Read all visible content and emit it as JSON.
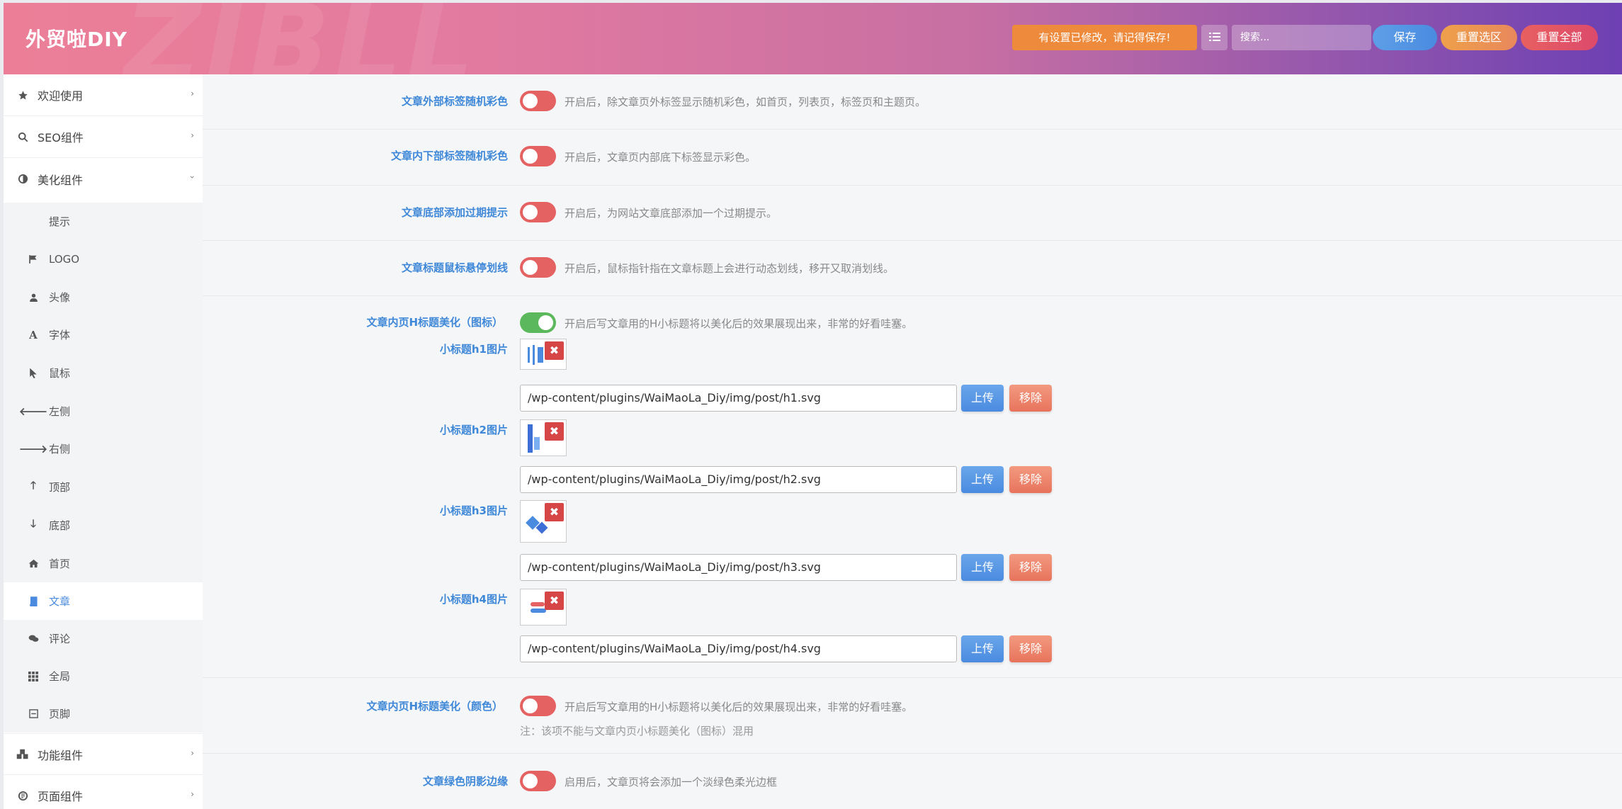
{
  "header": {
    "brand": "外贸啦DIY",
    "watermark": "ZIBLL",
    "notice": "有设置已修改，请记得保存!",
    "search_placeholder": "搜索...",
    "save": "保存",
    "reset_section": "重置选区",
    "reset_all": "重置全部"
  },
  "sidebar": {
    "main": [
      {
        "label": "欢迎使用",
        "icon": "star-icon"
      },
      {
        "label": "SEO组件",
        "icon": "search-icon"
      },
      {
        "label": "美化组件",
        "icon": "contrast-icon"
      }
    ],
    "sub": [
      {
        "label": "提示",
        "icon": ""
      },
      {
        "label": "LOGO",
        "icon": "flag-icon"
      },
      {
        "label": "头像",
        "icon": "user-icon"
      },
      {
        "label": "字体",
        "icon": "font-icon"
      },
      {
        "label": "鼠标",
        "icon": "pointer-icon"
      },
      {
        "label": "左侧",
        "icon": "arrow-left-icon"
      },
      {
        "label": "右侧",
        "icon": "arrow-right-icon"
      },
      {
        "label": "顶部",
        "icon": "arrow-up-icon"
      },
      {
        "label": "底部",
        "icon": "arrow-down-icon"
      },
      {
        "label": "首页",
        "icon": "home-icon"
      },
      {
        "label": "文章",
        "icon": "book-icon"
      },
      {
        "label": "评论",
        "icon": "comments-icon"
      },
      {
        "label": "全局",
        "icon": "grid-icon"
      },
      {
        "label": "页脚",
        "icon": "footer-icon"
      }
    ],
    "bottom": [
      {
        "label": "功能组件",
        "icon": "cubes-icon"
      },
      {
        "label": "页面组件",
        "icon": "page-icon"
      }
    ]
  },
  "settings": {
    "r1": {
      "label": "文章外部标签随机彩色",
      "desc": "开启后，除文章页外标签显示随机彩色，如首页，列表页，标签页和主题页。"
    },
    "r2": {
      "label": "文章内下部标签随机彩色",
      "desc": "开启后，文章页内部底下标签显示彩色。"
    },
    "r3": {
      "label": "文章底部添加过期提示",
      "desc": "开启后，为网站文章底部添加一个过期提示。"
    },
    "r4": {
      "label": "文章标题鼠标悬停划线",
      "desc": "开启后，鼠标指针指在文章标题上会进行动态划线，移开又取消划线。"
    },
    "r5": {
      "label": "文章内页H标题美化（图标）",
      "desc": "开启后写文章用的H小标题将以美化后的效果展现出来，非常的好看哇塞。",
      "images": [
        {
          "label": "小标题h1图片",
          "path": "/wp-content/plugins/WaiMaoLa_Diy/img/post/h1.svg"
        },
        {
          "label": "小标题h2图片",
          "path": "/wp-content/plugins/WaiMaoLa_Diy/img/post/h2.svg"
        },
        {
          "label": "小标题h3图片",
          "path": "/wp-content/plugins/WaiMaoLa_Diy/img/post/h3.svg"
        },
        {
          "label": "小标题h4图片",
          "path": "/wp-content/plugins/WaiMaoLa_Diy/img/post/h4.svg"
        }
      ],
      "upload": "上传",
      "remove": "移除"
    },
    "r6": {
      "label": "文章内页H标题美化（颜色）",
      "desc": "开启后写文章用的H小标题将以美化后的效果展现出来，非常的好看哇塞。",
      "note": "注：该项不能与文章内页小标题美化（图标）混用"
    },
    "r7": {
      "label": "文章绿色阴影边缘",
      "desc": "启用后，文章页将会添加一个淡绿色柔光边框"
    }
  },
  "colors": {
    "accent": "#4a8be0",
    "toggle_off": "#e56262",
    "toggle_on": "#5cb85c"
  }
}
